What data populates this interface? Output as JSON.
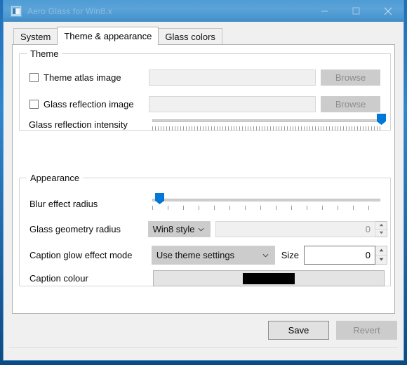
{
  "window": {
    "title": "Aero Glass for Win8.x",
    "icon": "app-icon",
    "controls": {
      "minimize": "–",
      "maximize": "□",
      "close": "✕"
    }
  },
  "tabs": [
    {
      "label": "System",
      "selected": false
    },
    {
      "label": "Theme & appearance",
      "selected": true
    },
    {
      "label": "Glass colors",
      "selected": false
    }
  ],
  "theme_group": {
    "title": "Theme",
    "atlas": {
      "label": "Theme atlas image",
      "checked": false,
      "value": "",
      "placeholder": "",
      "browse_label": "Browse",
      "enabled": false
    },
    "reflection": {
      "label": "Glass reflection image",
      "checked": false,
      "value": "",
      "placeholder": "",
      "browse_label": "Browse",
      "enabled": false
    },
    "intensity": {
      "label": "Glass reflection intensity",
      "value": 100,
      "min": 0,
      "max": 100
    }
  },
  "appearance_group": {
    "title": "Appearance",
    "blur": {
      "label": "Blur effect radius",
      "value": 3,
      "min": 0,
      "max": 100
    },
    "geometry": {
      "label": "Glass geometry radius",
      "selected_option": "Win8 style",
      "options": [
        "Win8 style"
      ],
      "size_value": "0",
      "size_enabled": false
    },
    "glow": {
      "label": "Caption glow effect mode",
      "selected_option": "Use theme settings",
      "options": [
        "Use theme settings"
      ],
      "size_label": "Size",
      "size_value": "0",
      "size_enabled": true
    },
    "caption_colour": {
      "label": "Caption colour",
      "swatch_colour": "#000000"
    }
  },
  "footer": {
    "save_label": "Save",
    "revert_label": "Revert",
    "revert_enabled": false
  }
}
